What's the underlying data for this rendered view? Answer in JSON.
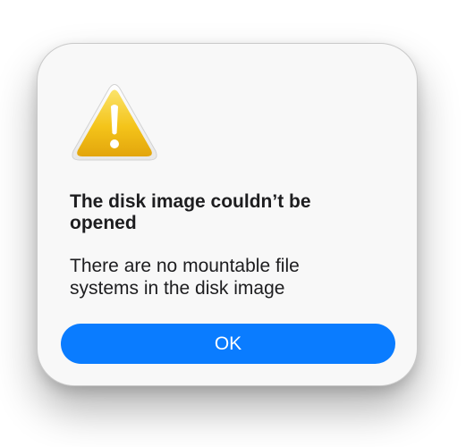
{
  "dialog": {
    "icon": "warning-triangle-icon",
    "title": "The disk image couldn’t be opened",
    "message": "There are no mountable file systems in the disk image",
    "ok_label": "OK"
  },
  "colors": {
    "button_blue": "#0a7cff",
    "warning_yellow": "#f5c518",
    "dialog_background": "#f8f8f8"
  }
}
